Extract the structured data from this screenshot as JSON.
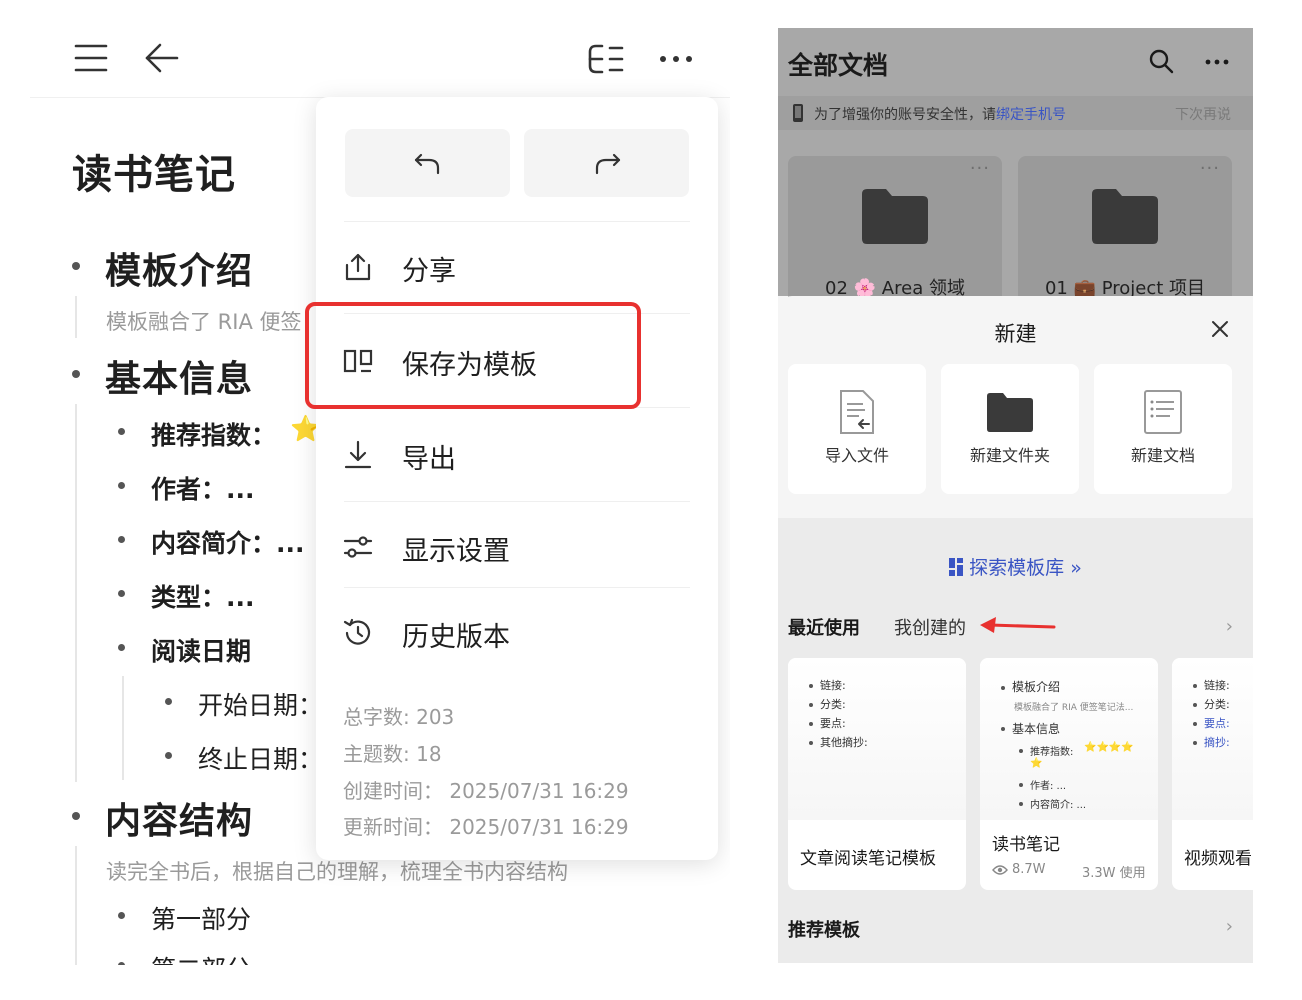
{
  "left": {
    "doc_title": "读书笔记",
    "outline": {
      "intro_heading": "模板介绍",
      "intro_note": "模板融合了 RIA 便签",
      "basic_heading": "基本信息",
      "recommend_label": "推荐指数：",
      "recommend_icon": "⭐",
      "author_label": "作者：...",
      "summary_label": "内容简介：...",
      "type_label": "类型：...",
      "read_date_label": "阅读日期",
      "start_date_label": "开始日期：",
      "end_date_label": "终止日期：",
      "structure_heading": "内容结构",
      "structure_note": "读完全书后，根据自己的理解，梳理全书内容结构",
      "part1": "第一部分",
      "part2": "第二部分"
    },
    "menu": {
      "undo": "undo-icon",
      "redo": "redo-icon",
      "items": [
        {
          "label": "分享",
          "icon": "share-icon"
        },
        {
          "label": "保存为模板",
          "icon": "template-icon"
        },
        {
          "label": "导出",
          "icon": "download-icon"
        },
        {
          "label": "显示设置",
          "icon": "sliders-icon"
        },
        {
          "label": "历史版本",
          "icon": "history-icon"
        }
      ],
      "stats": {
        "words": "总字数: 203",
        "topics": "主题数: 18",
        "created": "创建时间：  2025/07/31 16:29",
        "updated": "更新时间：  2025/07/31 16:29"
      }
    },
    "highlight_color": "#e8312f"
  },
  "right": {
    "title": "全部文档",
    "notice": {
      "text_before": "为了增强你的账号安全性，请",
      "link": "绑定手机号",
      "dismiss": "下次再说"
    },
    "folders": [
      {
        "name": "02 🌸 Area 领域"
      },
      {
        "name": "01 💼 Project 项目"
      }
    ],
    "sheet": {
      "title": "新建",
      "actions": [
        {
          "label": "导入文件",
          "icon": "import-file-icon"
        },
        {
          "label": "新建文件夹",
          "icon": "folder-icon"
        },
        {
          "label": "新建文档",
          "icon": "document-icon"
        }
      ],
      "explore": "探索模板库 »",
      "tab_recent": "最近使用",
      "tab_mine": "我创建的",
      "recommend": "推荐模板",
      "templates": [
        {
          "name": "文章阅读笔记模板",
          "lines": [
            "链接:",
            "分类:",
            "要点:",
            "其他摘抄:"
          ]
        },
        {
          "name": "读书笔记",
          "views": "8.7W",
          "uses": "3.3W 使用",
          "lines": [
            "模板介绍",
            "模板融合了 RIA 便签笔记法...",
            "基本信息",
            "推荐指数:",
            "⭐⭐⭐⭐",
            "⭐",
            "作者: ...",
            "内容简介: ..."
          ]
        },
        {
          "name": "视频观看",
          "lines": [
            "链接:",
            "分类:",
            "要点:",
            "摘抄:"
          ]
        }
      ]
    },
    "accent": "#3a55c4"
  }
}
